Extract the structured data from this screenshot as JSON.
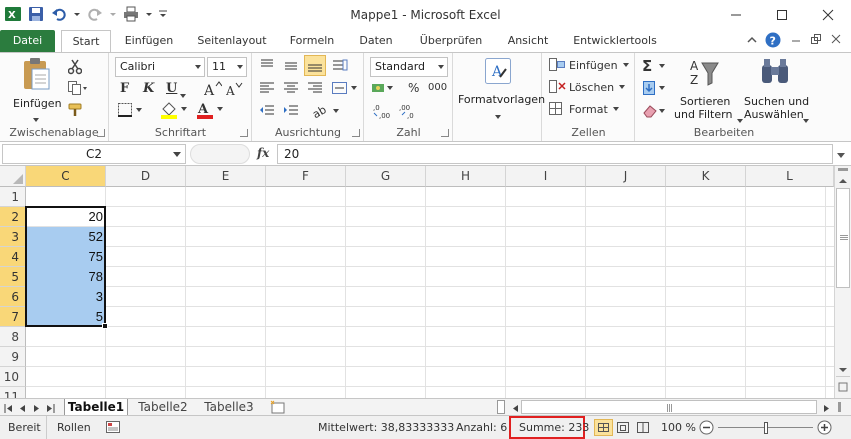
{
  "window": {
    "title": "Mappe1  -  Microsoft Excel"
  },
  "tabs": [
    "Datei",
    "Start",
    "Einfügen",
    "Seitenlayout",
    "Formeln",
    "Daten",
    "Überprüfen",
    "Ansicht",
    "Entwicklertools"
  ],
  "ribbon": {
    "clipboard": {
      "paste": "Einfügen",
      "label": "Zwischenablage"
    },
    "font": {
      "name": "Calibri",
      "size": "11",
      "label": "Schriftart",
      "bold": "F",
      "italic": "K",
      "underline": "U"
    },
    "alignment": {
      "label": "Ausrichtung"
    },
    "number": {
      "format": "Standard",
      "percent": "%",
      "thousands": "000",
      "label": "Zahl"
    },
    "styles": {
      "format_templates": "Formatvorlagen"
    },
    "cells": {
      "insert": "Einfügen",
      "delete": "Löschen",
      "format": "Format",
      "label": "Zellen"
    },
    "editing": {
      "sigma": "Σ",
      "sort": "Sortieren",
      "filter": "und Filtern",
      "find": "Suchen und",
      "select": "Auswählen",
      "label": "Bearbeiten"
    }
  },
  "formula_bar": {
    "name_box": "C2",
    "fx": "fx",
    "content": "20"
  },
  "grid": {
    "columns": [
      "C",
      "D",
      "E",
      "F",
      "G",
      "H",
      "I",
      "J",
      "K",
      "L"
    ],
    "rows": [
      "1",
      "2",
      "3",
      "4",
      "5",
      "6",
      "7",
      "8",
      "9",
      "10",
      "11"
    ],
    "values": [
      "20",
      "52",
      "75",
      "78",
      "3",
      "5"
    ]
  },
  "sheets": [
    "Tabelle1",
    "Tabelle2",
    "Tabelle3"
  ],
  "status": {
    "ready": "Bereit",
    "scroll": "Rollen",
    "average": "Mittelwert: 38,83333333",
    "count": "Anzahl: 6",
    "sum": "Summe: 233",
    "zoom": "100 %"
  },
  "colors": {
    "accent_green": "#2b7c3e",
    "selection_header": "#f9d778",
    "selected_cells": "#a8ccf0",
    "sum_highlight": "#e02020"
  }
}
